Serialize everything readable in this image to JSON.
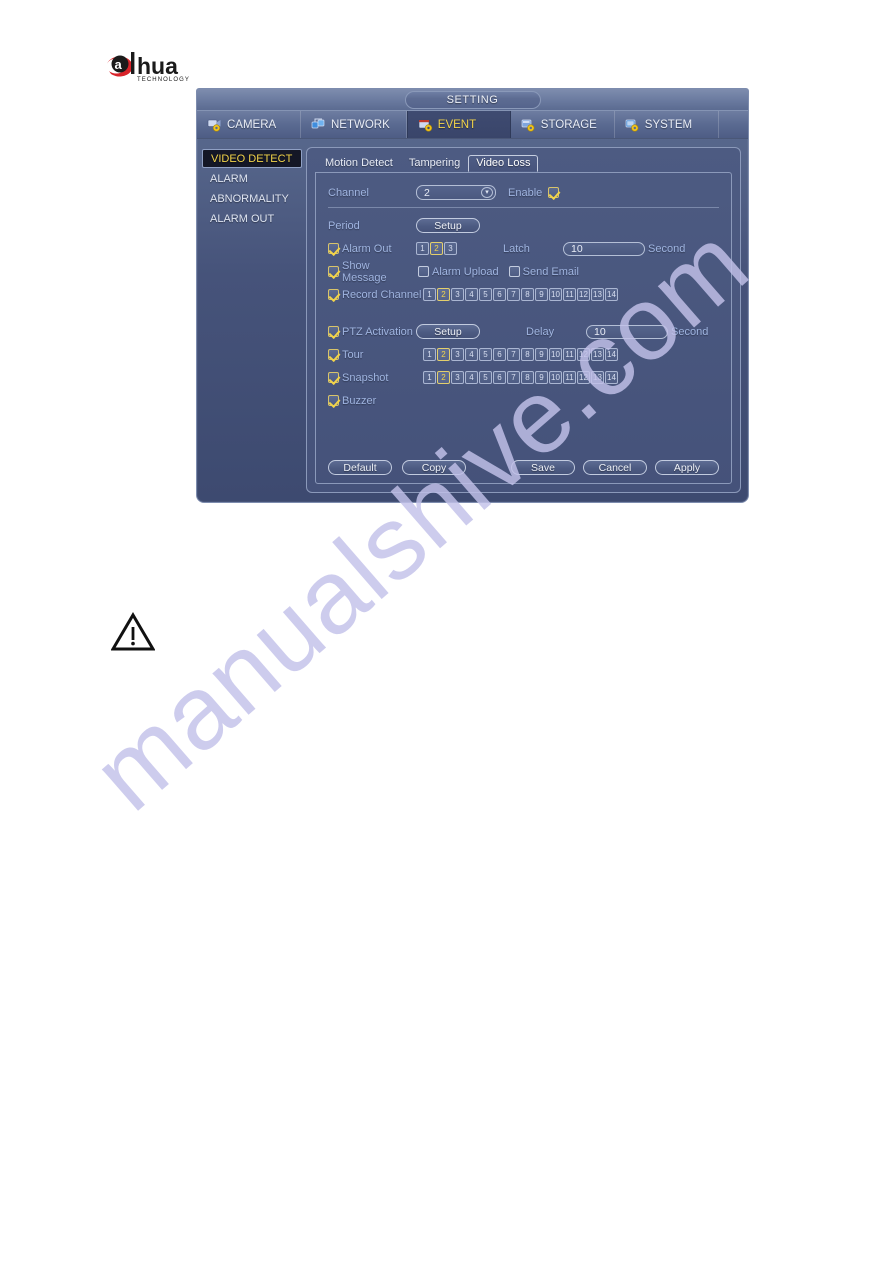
{
  "brand": {
    "name": "alhua",
    "tagline": "TECHNOLOGY"
  },
  "watermark": {
    "text": "manualshive.com"
  },
  "window": {
    "title": "SETTING",
    "tabs": [
      {
        "label": "CAMERA",
        "icon": "camera-icon",
        "active": false
      },
      {
        "label": "NETWORK",
        "icon": "network-icon",
        "active": false
      },
      {
        "label": "EVENT",
        "icon": "event-icon",
        "active": true
      },
      {
        "label": "STORAGE",
        "icon": "storage-icon",
        "active": false
      },
      {
        "label": "SYSTEM",
        "icon": "system-icon",
        "active": false
      }
    ]
  },
  "sidebar": {
    "items": [
      {
        "label": "VIDEO DETECT",
        "selected": true
      },
      {
        "label": "ALARM",
        "selected": false
      },
      {
        "label": "ABNORMALITY",
        "selected": false
      },
      {
        "label": "ALARM OUT",
        "selected": false
      }
    ]
  },
  "subtabs": [
    {
      "label": "Motion Detect",
      "active": false
    },
    {
      "label": "Tampering",
      "active": false
    },
    {
      "label": "Video Loss",
      "active": true
    }
  ],
  "form": {
    "channel": {
      "label": "Channel",
      "value": "2",
      "dropdown_glyph": "▾"
    },
    "enable": {
      "label": "Enable",
      "checked": true
    },
    "period": {
      "label": "Period",
      "button": "Setup"
    },
    "alarm_out": {
      "label": "Alarm Out",
      "checked": true,
      "channels": [
        "1",
        "2",
        "3"
      ],
      "selected": [
        "2"
      ]
    },
    "latch": {
      "label": "Latch",
      "value": "10",
      "unit": "Second"
    },
    "show_message": {
      "label": "Show Message",
      "checked": true
    },
    "alarm_upload": {
      "label": "Alarm Upload",
      "checked": false
    },
    "send_email": {
      "label": "Send Email",
      "checked": false
    },
    "record_channel": {
      "label": "Record Channel",
      "checked": true,
      "channels": [
        "1",
        "2",
        "3",
        "4",
        "5",
        "6",
        "7",
        "8",
        "9",
        "10",
        "11",
        "12",
        "13",
        "14"
      ],
      "selected": [
        "2"
      ]
    },
    "ptz_activation": {
      "label": "PTZ Activation",
      "checked": true,
      "button": "Setup"
    },
    "delay": {
      "label": "Delay",
      "value": "10",
      "unit": "Second"
    },
    "tour": {
      "label": "Tour",
      "checked": true,
      "channels": [
        "1",
        "2",
        "3",
        "4",
        "5",
        "6",
        "7",
        "8",
        "9",
        "10",
        "11",
        "12",
        "13",
        "14"
      ],
      "selected": [
        "2"
      ]
    },
    "snapshot": {
      "label": "Snapshot",
      "checked": true,
      "channels": [
        "1",
        "2",
        "3",
        "4",
        "5",
        "6",
        "7",
        "8",
        "9",
        "10",
        "11",
        "12",
        "13",
        "14"
      ],
      "selected": [
        "2"
      ]
    },
    "buzzer": {
      "label": "Buzzer",
      "checked": true
    }
  },
  "footer": {
    "default_label": "Default",
    "copy_label": "Copy",
    "save_label": "Save",
    "cancel_label": "Cancel",
    "apply_label": "Apply"
  },
  "note": {
    "icon": "warning-triangle-icon"
  },
  "colors": {
    "accent_yellow": "#f2d44a",
    "panel_blue": "#4d5b82",
    "label_blue": "#9fb4e0",
    "brand_red": "#d8232a",
    "watermark": "#c3c2ea"
  }
}
